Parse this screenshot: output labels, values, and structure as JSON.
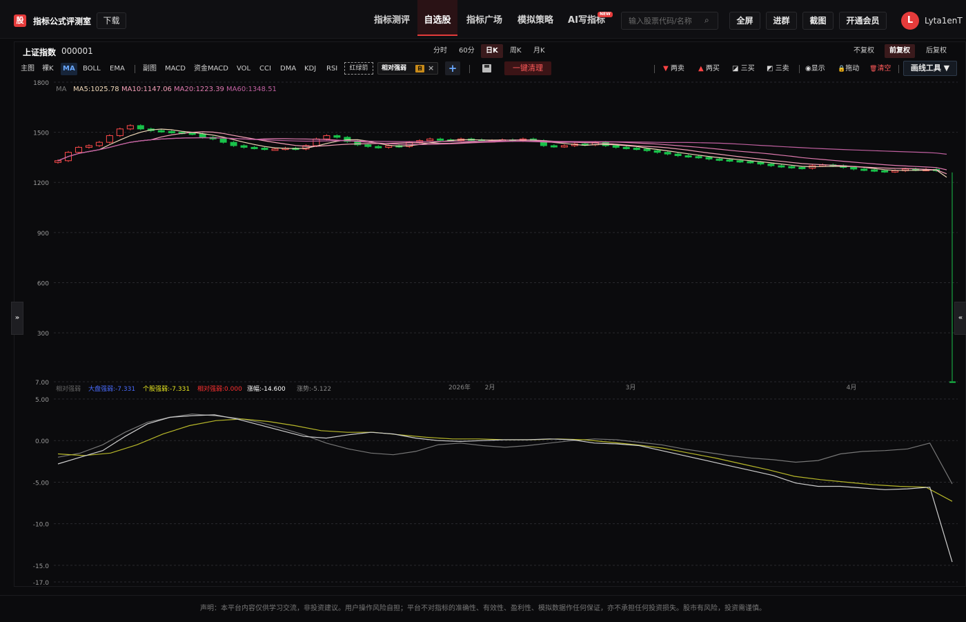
{
  "app": {
    "logo": "股",
    "title": "指标公式评测室",
    "download": "下载"
  },
  "nav": [
    {
      "label": "指标测评"
    },
    {
      "label": "自选股"
    },
    {
      "label": "指标广场"
    },
    {
      "label": "模拟策略"
    },
    {
      "label": "AI写指标"
    }
  ],
  "nav_badge": "NEW",
  "search": {
    "placeholder": "输入股票代码/名称"
  },
  "top_buttons": [
    {
      "label": "全屏"
    },
    {
      "label": "进群"
    },
    {
      "label": "截图"
    },
    {
      "label": "开通会员"
    }
  ],
  "user": {
    "initial": "L",
    "name": "Lyta1enT"
  },
  "stock": {
    "name": "上证指数",
    "code": "000001"
  },
  "periods": [
    {
      "label": "分时"
    },
    {
      "label": "60分"
    },
    {
      "label": "日K"
    },
    {
      "label": "周K"
    },
    {
      "label": "月K"
    }
  ],
  "fuquan": [
    {
      "label": "不复权"
    },
    {
      "label": "前复权"
    },
    {
      "label": "后复权"
    }
  ],
  "indicators": [
    {
      "label": "主图"
    },
    {
      "label": "裸K"
    },
    {
      "label": "MA"
    },
    {
      "label": "BOLL"
    },
    {
      "label": "EMA"
    },
    {
      "label": "副图"
    },
    {
      "label": "MACD"
    },
    {
      "label": "资金MACD"
    },
    {
      "label": "VOL"
    },
    {
      "label": "CCI"
    },
    {
      "label": "DMA"
    },
    {
      "label": "KDJ"
    },
    {
      "label": "RSI"
    }
  ],
  "hongluzhen": "红绿箭",
  "xiangdui": {
    "label": "相对强弱",
    "badge": "自",
    "close": "×"
  },
  "add": "+",
  "clear": "一键清理",
  "tools": [
    {
      "icon": "▼",
      "label": "两卖",
      "color": "#ff4444"
    },
    {
      "icon": "▲",
      "label": "两买",
      "color": "#ff4444"
    },
    {
      "icon": "◪",
      "label": "三买",
      "color": "#ddd"
    },
    {
      "icon": "◩",
      "label": "三卖",
      "color": "#ddd"
    },
    {
      "icon": "◉",
      "label": "显示",
      "color": "#ddd"
    },
    {
      "icon": "🔒",
      "label": "拖动",
      "color": "#ddd"
    },
    {
      "icon": "🗑",
      "label": "清空",
      "color": "#ff5a5a"
    }
  ],
  "draw_tool": "画线工具 ▼",
  "side_left": "»",
  "side_right": "«",
  "ma_legend": {
    "name": "MA",
    "items": [
      {
        "label": "MA5:1025.78",
        "color": "#f0d8b8"
      },
      {
        "label": "MA10:1147.06",
        "color": "#f5a0b8"
      },
      {
        "label": "MA20:1223.39",
        "color": "#e07ab0"
      },
      {
        "label": "MA60:1348.51",
        "color": "#c060a0"
      }
    ]
  },
  "sub_legend": {
    "name": "相对强弱",
    "items": [
      {
        "label": "大盘强弱:-7.331",
        "color": "#4a6cff"
      },
      {
        "label": "个股强弱:-7.331",
        "color": "#e8e820"
      },
      {
        "label": "相对强弱:0.000",
        "color": "#ff3030"
      },
      {
        "label": "涨幅:-14.600",
        "color": "#ffffff"
      },
      {
        "label": "涨势:-5.122",
        "color": "#888888"
      }
    ]
  },
  "disclaimer": "声明：本平台内容仅供学习交流，非投资建议。用户操作风险自担；平台不对指标的准确性、有效性、盈利性、模拟数据作任何保证，亦不承担任何投资损失。股市有风险，投资需谨慎。",
  "chart_data": [
    {
      "type": "candlestick",
      "title": "上证指数 日K",
      "yticks": [
        "1800",
        "1500",
        "1200",
        "900",
        "600",
        "300",
        "7.00"
      ],
      "ylim": [
        7,
        1800
      ],
      "xticks": [
        "2026年",
        "2月",
        "3月",
        "4月"
      ],
      "ohlc_close": [
        1330,
        1380,
        1410,
        1420,
        1440,
        1480,
        1520,
        1540,
        1520,
        1510,
        1505,
        1500,
        1495,
        1490,
        1470,
        1460,
        1440,
        1420,
        1410,
        1405,
        1400,
        1400,
        1405,
        1400,
        1420,
        1460,
        1480,
        1470,
        1445,
        1425,
        1415,
        1410,
        1420,
        1415,
        1440,
        1450,
        1460,
        1455,
        1450,
        1460,
        1455,
        1450,
        1450,
        1455,
        1450,
        1460,
        1450,
        1420,
        1415,
        1420,
        1430,
        1425,
        1440,
        1420,
        1410,
        1405,
        1400,
        1390,
        1380,
        1370,
        1360,
        1355,
        1350,
        1340,
        1335,
        1330,
        1325,
        1320,
        1310,
        1300,
        1295,
        1290,
        1285,
        1300,
        1305,
        1300,
        1290,
        1280,
        1275,
        1270,
        1265,
        1270,
        1280,
        1275,
        1278,
        1270,
        1050
      ],
      "grid": true
    },
    {
      "type": "line",
      "title": "相对强弱",
      "yticks": [
        "5.00",
        "0.00",
        "-5.00",
        "-10.0",
        "-15.0",
        "-17.0"
      ],
      "ylim": [
        -17,
        5
      ],
      "series": [
        {
          "name": "大盘强弱",
          "values": [
            -2,
            -1.5,
            -0.5,
            1,
            2.2,
            2.8,
            3.2,
            3.0,
            2.7,
            2.2,
            1.5,
            0.7,
            -0.3,
            -1.0,
            -1.5,
            -1.7,
            -1.3,
            -0.5,
            -0.3,
            -0.6,
            -0.8,
            -0.6,
            -0.3,
            0,
            0.2,
            0.1,
            -0.2,
            -0.5,
            -1.0,
            -1.4,
            -1.8,
            -2.1,
            -2.3,
            -2.6,
            -2.4,
            -1.6,
            -1.3,
            -1.2,
            -1.0,
            -0.3,
            -5.2
          ]
        },
        {
          "name": "个股强弱",
          "values": [
            -1.6,
            -1.8,
            -1.5,
            -0.5,
            0.8,
            1.8,
            2.4,
            2.6,
            2.3,
            1.8,
            1.2,
            1.0,
            1.0,
            0.7,
            0.4,
            0.2,
            0.2,
            0.1,
            0.1,
            0.2,
            0.1,
            -0.2,
            -0.5,
            -0.9,
            -1.5,
            -2.1,
            -2.8,
            -3.5,
            -4.3,
            -4.7,
            -5.0,
            -5.3,
            -5.5,
            -5.6,
            -7.3
          ]
        },
        {
          "name": "涨幅",
          "values": [
            -2.8,
            -2,
            -1.2,
            0.5,
            2.0,
            2.8,
            3.0,
            3.1,
            2.6,
            1.9,
            1.2,
            0.5,
            0.3,
            0.7,
            1.0,
            0.8,
            0.3,
            0,
            -0.1,
            0,
            0.1,
            0.1,
            0.2,
            0.1,
            -0.3,
            -0.4,
            -0.6,
            -1.2,
            -1.8,
            -2.4,
            -3.0,
            -3.6,
            -4.2,
            -5.1,
            -5.5,
            -5.5,
            -5.7,
            -5.9,
            -5.8,
            -5.6,
            -14.6
          ]
        }
      ],
      "grid": true
    }
  ]
}
